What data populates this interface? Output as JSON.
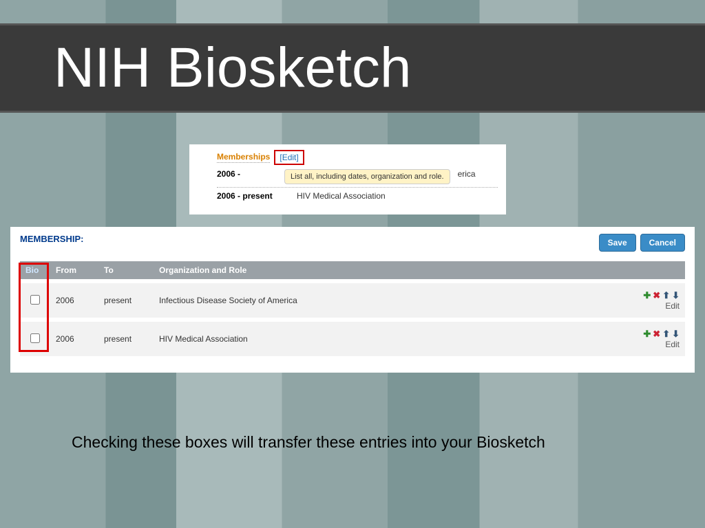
{
  "title": "NIH Biosketch",
  "top_panel": {
    "section_title": "Memberships",
    "edit_text": "[Edit]",
    "tooltip": "List all, including dates, organization and role.",
    "row1_dates": "2006 -",
    "row1_suffix": "erica",
    "row2_dates": "2006 - present",
    "row2_org": "HIV Medical Association"
  },
  "main_panel": {
    "heading": "MEMBERSHIP:",
    "save": "Save",
    "cancel": "Cancel",
    "columns": {
      "bio": "Bio",
      "from": "From",
      "to": "To",
      "org": "Organization and Role"
    },
    "rows": [
      {
        "from": "2006",
        "to": "present",
        "org": "Infectious Disease Society of America",
        "edit": "Edit"
      },
      {
        "from": "2006",
        "to": "present",
        "org": "HIV Medical Association",
        "edit": "Edit"
      }
    ]
  },
  "caption": "Checking these boxes will transfer these entries into your Biosketch"
}
